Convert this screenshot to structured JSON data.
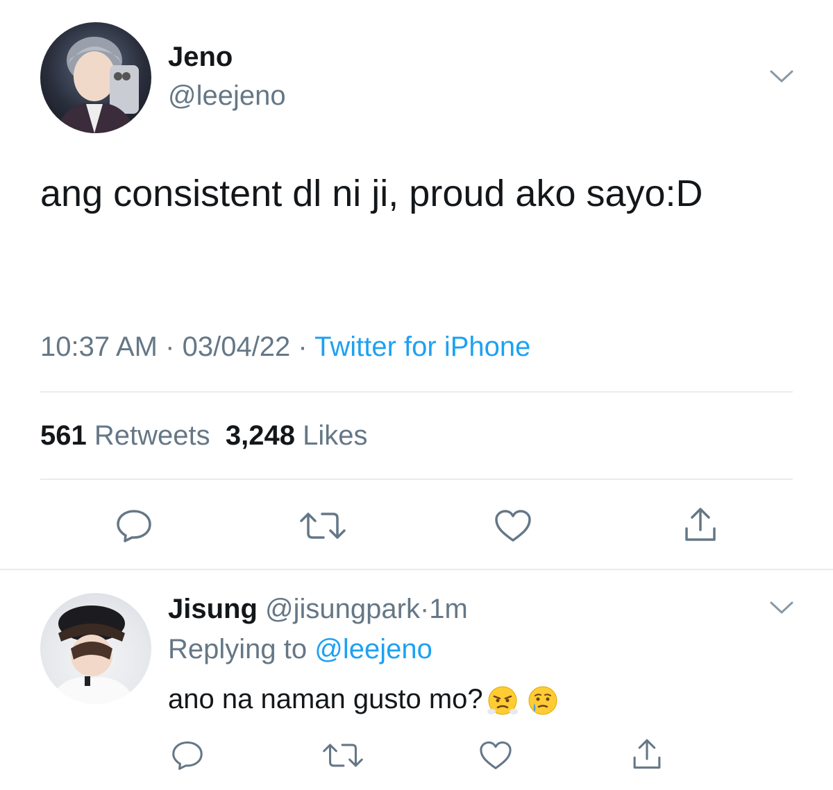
{
  "main_tweet": {
    "author_name": "Jeno",
    "author_handle": "@leejeno",
    "text": "ang consistent dl ni ji, proud ako sayo:D",
    "time": "10:37 AM",
    "date": "03/04/22",
    "source": "Twitter for iPhone",
    "separator": "·",
    "retweets_count": "561",
    "retweets_label": "Retweets",
    "likes_count": "3,248",
    "likes_label": "Likes"
  },
  "reply": {
    "author_name": "Jisung",
    "author_handle": "@jisungpark",
    "separator": "·",
    "time_ago": "1m",
    "replying_to_label": "Replying to",
    "replying_to_handle": "@leejeno",
    "text": "ano na naman gusto mo?"
  },
  "icons": {
    "reply": "reply-icon",
    "retweet": "retweet-icon",
    "like": "heart-icon",
    "share": "share-icon",
    "more": "chevron-down-icon"
  },
  "colors": {
    "text_primary": "#14171a",
    "text_secondary": "#657786",
    "link": "#1da1f2",
    "divider": "#e6ecf0"
  }
}
